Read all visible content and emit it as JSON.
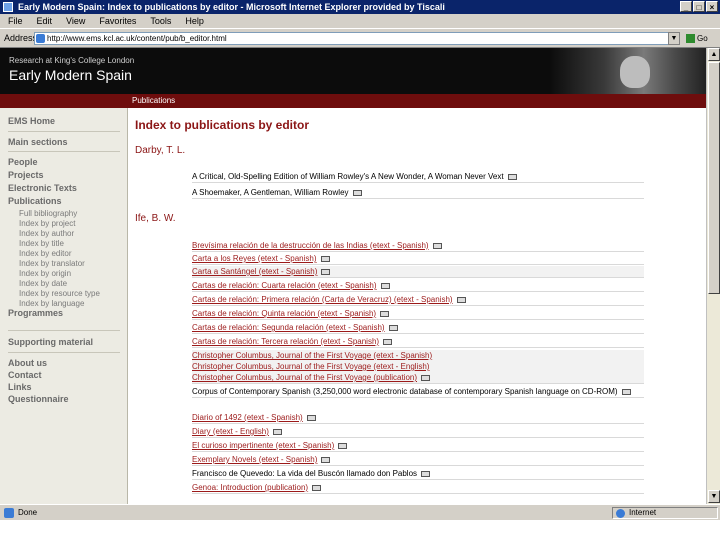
{
  "window": {
    "title": "Early Modern Spain: Index to publications by editor - Microsoft Internet Explorer provided by Tiscali",
    "buttons": [
      "_",
      "□",
      "×"
    ]
  },
  "menu": [
    "File",
    "Edit",
    "View",
    "Favorites",
    "Tools",
    "Help"
  ],
  "address": {
    "label": "Address",
    "url": "http://www.ems.kcl.ac.uk/content/pub/b_editor.html",
    "go_label": "Go",
    "dropdown": "▼"
  },
  "banner": {
    "subtitle": "Research at King's College London",
    "title": "Early Modern Spain"
  },
  "section_bar": "Publications",
  "sidebar": {
    "groups": [
      {
        "label": "EMS Home"
      },
      {
        "label": "Main sections"
      },
      {
        "label": "People"
      },
      {
        "label": "Projects"
      },
      {
        "label": "Electronic Texts"
      },
      {
        "label": "Publications"
      }
    ],
    "sub_items": [
      "Full bibliography",
      "Index by project",
      "Index by author",
      "Index by title",
      "Index by editor",
      "Index by translator",
      "Index by origin",
      "Index by date",
      "Index by resource type",
      "Index by language"
    ],
    "after": [
      {
        "label": "Programmes"
      },
      {
        "label": "Supporting material"
      },
      {
        "label": "About us"
      },
      {
        "label": "Contact"
      },
      {
        "label": "Links"
      },
      {
        "label": "Questionnaire"
      }
    ]
  },
  "main": {
    "title": "Index to publications by editor",
    "editors": [
      {
        "name": "Darby, T. L.",
        "items": [
          {
            "text": "A Critical, Old-Spelling Edition of William Rowley's A New Wonder, A Woman Never Vext",
            "link": false
          },
          {
            "text": "A Shoemaker, A Gentleman, William Rowley",
            "link": false
          }
        ]
      },
      {
        "name": "Ife, B. W.",
        "items": [
          {
            "text": "Brevísima relación de la destrucción de las Indias (etext - Spanish)",
            "link": true
          },
          {
            "text": "Carta a los Reyes (etext - Spanish)",
            "link": true
          },
          {
            "text": "Carta a Santángel (etext - Spanish)",
            "link": true
          },
          {
            "text": "Cartas de relación: Cuarta relación (etext - Spanish)",
            "link": true
          },
          {
            "text": "Cartas de relación: Primera relación (Carta de Veracruz) (etext - Spanish)",
            "link": true
          },
          {
            "text": "Cartas de relación: Quinta relación (etext - Spanish)",
            "link": true
          },
          {
            "text": "Cartas de relación: Segunda relación (etext - Spanish)",
            "link": true
          },
          {
            "text": "Cartas de relación: Tercera relación (etext - Spanish)",
            "link": true
          },
          {
            "text": "Christopher Columbus, Journal of the First Voyage (etext - Spanish)",
            "link": true
          },
          {
            "text": "Christopher Columbus, Journal of the First Voyage (etext - English)",
            "link": true
          },
          {
            "text": "Christopher Columbus, Journal of the First Voyage (publication)",
            "link": true
          },
          {
            "text": "Corpus of Contemporary Spanish (3,250,000 word electronic database of contemporary Spanish language on CD-ROM)",
            "link": false,
            "wrap": true
          },
          {
            "text": "Diario of 1492 (etext - Spanish)",
            "link": true
          },
          {
            "text": "Diary (etext - English)",
            "link": true
          },
          {
            "text": "El curioso impertinente (etext - Spanish)",
            "link": true
          },
          {
            "text": "Exemplary Novels (etext - Spanish)",
            "link": true
          },
          {
            "text": "Francisco de Quevedo: La vida del Buscón llamado don Pablos",
            "link": false
          },
          {
            "text": "Genoa: Introduction (publication)",
            "link": true
          }
        ]
      }
    ]
  },
  "status": {
    "text": "Done",
    "zone": "Internet"
  }
}
